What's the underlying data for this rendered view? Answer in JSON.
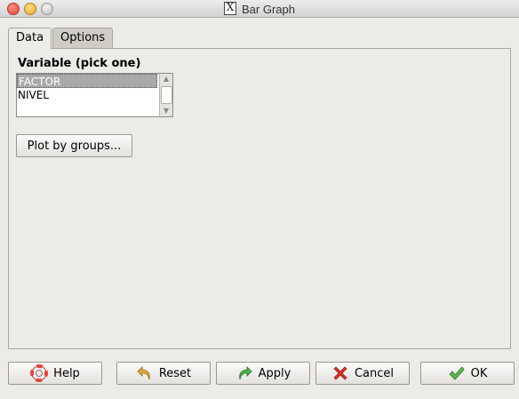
{
  "window": {
    "title": "Bar Graph"
  },
  "tabs": [
    {
      "label": "Data",
      "active": true
    },
    {
      "label": "Options",
      "active": false
    }
  ],
  "data_tab": {
    "variable_label": "Variable (pick one)",
    "variables": [
      {
        "label": "FACTOR",
        "selected": true
      },
      {
        "label": "NIVEL",
        "selected": false
      }
    ],
    "plot_by_groups_label": "Plot by groups..."
  },
  "buttons": {
    "help": {
      "label": "Help",
      "icon": "lifebuoy-icon"
    },
    "reset": {
      "label": "Reset",
      "icon": "undo-arrow-icon"
    },
    "apply": {
      "label": "Apply",
      "icon": "redo-arrow-icon"
    },
    "cancel": {
      "label": "Cancel",
      "icon": "red-x-icon"
    },
    "ok": {
      "label": "OK",
      "icon": "green-check-icon"
    }
  },
  "colors": {
    "window_bg": "#edebe7",
    "selection_bg": "#a9a9a9",
    "cancel_red": "#d9322a",
    "ok_green": "#3d9b2f",
    "apply_green": "#3aa13a"
  }
}
